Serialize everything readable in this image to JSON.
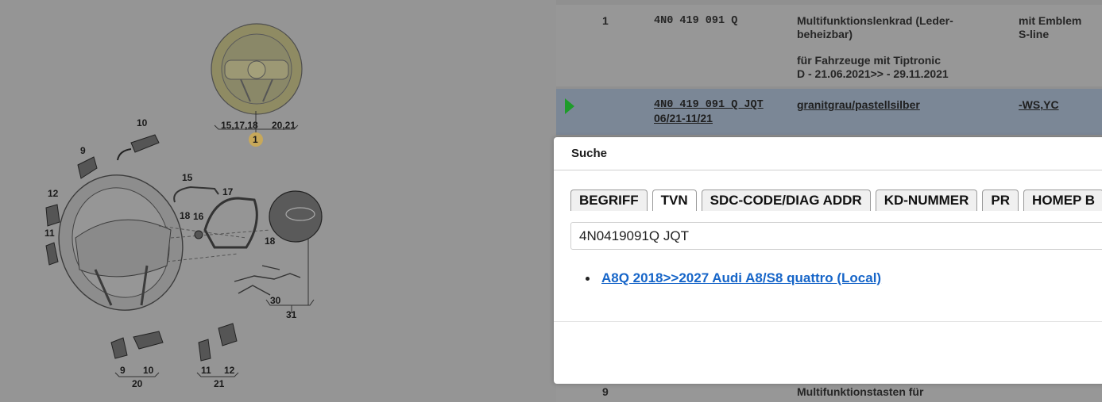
{
  "diagram": {
    "callouts": [
      "1",
      "9",
      "10",
      "11",
      "12",
      "15",
      "16",
      "17",
      "18",
      "18",
      "30",
      "31",
      "9",
      "10",
      "20",
      "11",
      "12",
      "21"
    ],
    "group_labels": {
      "top_left": "15,17,18",
      "top_right": "20,21"
    }
  },
  "parts_table": {
    "rows": [
      {
        "pos": "1",
        "part_no": "4N0 419 091 Q",
        "desc_line1": "Multifunktionslenkrad (Leder-",
        "desc_line2": "beheizbar)",
        "desc_line3": "für Fahrzeuge mit Tiptronic",
        "desc_line4": "D - 21.06.2021>> - 29.11.2021",
        "note_line1": "mit Emblem",
        "note_line2": "S-line"
      },
      {
        "part_no": "4N0 419 091 Q JQT",
        "date_range": "06/21-11/21",
        "desc": "granitgrau/pastellsilber",
        "note": "-WS,YC",
        "selected": true
      },
      {
        "pos": "9",
        "desc": "Multifunktionstasten für"
      }
    ]
  },
  "dialog": {
    "title": "Suche",
    "tabs": [
      "BEGRIFF",
      "TVN",
      "SDC-CODE/DIAG ADDR",
      "KD-NUMMER",
      "PR",
      "HOMEP B"
    ],
    "active_tab": "TVN",
    "search_value": "4N0419091Q JQT",
    "results": [
      "A8Q 2018>>2027 Audi A8/S8 quattro (Local)"
    ]
  },
  "colors": {
    "link": "#1665c8",
    "arrow": "#1e9c2a",
    "highlight": "#e6c86a"
  }
}
